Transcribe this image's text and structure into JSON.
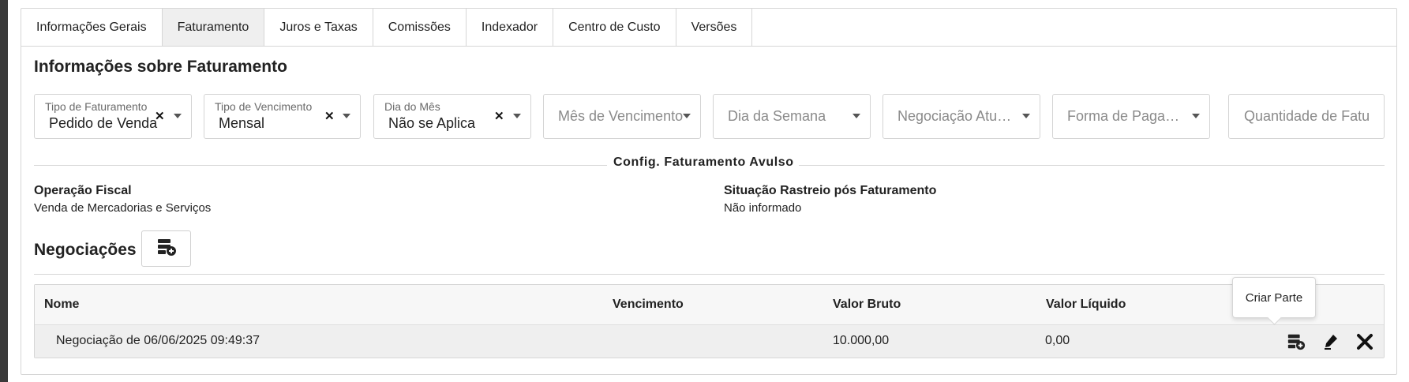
{
  "tabs": [
    {
      "label": "Informações Gerais"
    },
    {
      "label": "Faturamento"
    },
    {
      "label": "Juros e Taxas"
    },
    {
      "label": "Comissões"
    },
    {
      "label": "Indexador"
    },
    {
      "label": "Centro de Custo"
    },
    {
      "label": "Versões"
    }
  ],
  "active_tab": "Faturamento",
  "section_title": "Informações sobre Faturamento",
  "fields": {
    "tipo_faturamento": {
      "label": "Tipo de Faturamento",
      "value": "Pedido de Venda"
    },
    "tipo_vencimento": {
      "label": "Tipo de Vencimento",
      "value": "Mensal"
    },
    "dia_mes": {
      "label": "Dia do Mês",
      "value": "Não se Aplica"
    },
    "mes_vencimento": {
      "placeholder": "Mês de Vencimento"
    },
    "dia_semana": {
      "placeholder": "Dia da Semana"
    },
    "negociacao_atual": {
      "placeholder": "Negociação Atu…"
    },
    "forma_pagamento": {
      "placeholder": "Forma de Paga…"
    },
    "quantidade": {
      "placeholder": "Quantidade de Fatu"
    }
  },
  "config_title": "Config. Faturamento Avulso",
  "info": {
    "operacao_fiscal_label": "Operação Fiscal",
    "operacao_fiscal_value": "Venda de Mercadorias e Serviços",
    "situacao_label": "Situação Rastreio pós Faturamento",
    "situacao_value": "Não informado"
  },
  "negociacoes": {
    "title": "Negociações",
    "add_icon": "add-record-icon",
    "columns": [
      "Nome",
      "Vencimento",
      "Valor Bruto",
      "Valor Líquido"
    ],
    "rows": [
      {
        "nome": "Negociação de 06/06/2025 09:49:37",
        "vencimento": "",
        "valor_bruto": "10.000,00",
        "valor_liquido": "0,00"
      }
    ],
    "row_actions": [
      "create-part-icon",
      "edit-icon",
      "delete-icon"
    ],
    "tooltip": "Criar Parte"
  }
}
